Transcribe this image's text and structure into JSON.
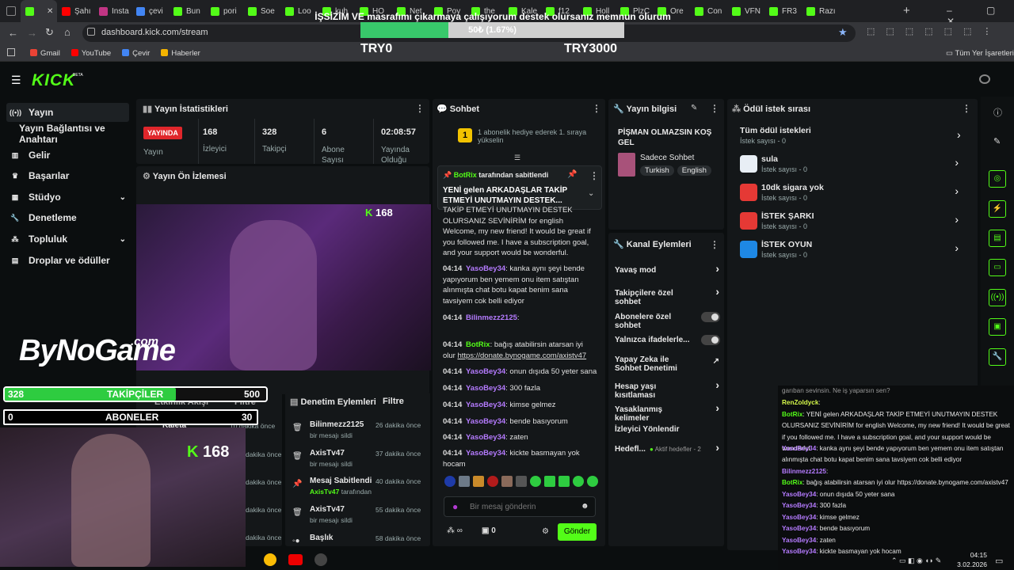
{
  "browser": {
    "tabs": [
      {
        "label": "",
        "color": "#53fc18"
      },
      {
        "label": "Şahı",
        "color": "#ff0000"
      },
      {
        "label": "Insta",
        "color": "#c13584"
      },
      {
        "label": "çevi",
        "color": "#4285f4"
      },
      {
        "label": "Bun",
        "color": "#53fc18"
      },
      {
        "label": "pori",
        "color": "#53fc18"
      },
      {
        "label": "Soe",
        "color": "#53fc18"
      },
      {
        "label": "Loo",
        "color": "#53fc18"
      },
      {
        "label": "kuh",
        "color": "#53fc18"
      },
      {
        "label": "HO",
        "color": "#53fc18"
      },
      {
        "label": "Net",
        "color": "#53fc18"
      },
      {
        "label": "Poy",
        "color": "#53fc18"
      },
      {
        "label": "the",
        "color": "#53fc18"
      },
      {
        "label": "Kale",
        "color": "#53fc18"
      },
      {
        "label": "f12",
        "color": "#53fc18"
      },
      {
        "label": "Holl",
        "color": "#53fc18"
      },
      {
        "label": "PlzC",
        "color": "#53fc18"
      },
      {
        "label": "Ore",
        "color": "#53fc18"
      },
      {
        "label": "Con",
        "color": "#53fc18"
      },
      {
        "label": "VFN",
        "color": "#53fc18"
      },
      {
        "label": "FR3",
        "color": "#53fc18"
      },
      {
        "label": "Razı",
        "color": "#53fc18"
      }
    ],
    "url": "dashboard.kick.com/stream",
    "bookmarks": [
      "Gmail",
      "YouTube",
      "Çevir",
      "Haberler"
    ],
    "all_bookmarks": "Tüm Yer İşaretleri"
  },
  "goal_overlay": {
    "title": "İŞSİZİM VE masrafımı çıkarmaya çalışıyorum destek olursanız memnun olurum",
    "progress_text": "50₺ (1.67%)",
    "progress_fraction": 0.0167,
    "left_label": "TRY0",
    "right_label": "TRY3000"
  },
  "brand": {
    "logo": "KICK",
    "beta": "BETA",
    "accent": "#53fc18"
  },
  "sidebar": {
    "items": [
      {
        "label": "Yayın",
        "icon": "broadcast-icon"
      },
      {
        "label": "Yayın Bağlantısı ve Anahtarı",
        "icon": ""
      },
      {
        "label": "Gelir",
        "icon": "money-icon"
      },
      {
        "label": "Başarılar",
        "icon": "trophy-icon"
      },
      {
        "label": "Stüdyo",
        "icon": "studio-icon"
      },
      {
        "label": "Denetleme",
        "icon": "wrench-icon"
      },
      {
        "label": "Topluluk",
        "icon": "community-icon"
      },
      {
        "label": "Droplar ve ödüller",
        "icon": "gift-icon"
      }
    ]
  },
  "stats": {
    "title": "Yayın İstatistikleri",
    "live_badge": "YAYINDA",
    "live_label": "Yayın",
    "viewers": "168",
    "viewers_label": "İzleyici",
    "followers": "328",
    "followers_label": "Takipçi",
    "subs": "6",
    "subs_label": "Abone Sayısı",
    "uptime": "02:08:57",
    "uptime_label": "Yayında Olduğu"
  },
  "preview": {
    "title": "Yayın Ön İzlemesi",
    "viewer_count": "168",
    "watermark": "ByNoGame",
    "watermark_sub": ".com"
  },
  "chat": {
    "title": "Sohbet",
    "gift_notice": "1 abonelik hediye ederek 1. sıraya yükselin",
    "pinned_by_user": "BotRix",
    "pinned_by_suffix": "tarafından sabitlendi",
    "pinned_text": "YENİ gelen ARKADAŞLAR TAKİP ETMEYİ UNUTMAYIN DESTEK...",
    "intro_text": "TAKİP ETMEYİ UNUTMAYIN DESTEK OLURSANIZ SEVİNİRİM for english Welcome, my new friend! It would be great if you followed me. I have a subscription goal, and your support would be wonderful.",
    "messages": [
      {
        "time": "04:14",
        "user": "YasoBey34",
        "text": "kanka aynı şeyi bende yapıyorum ben yemem onu item satıştan alınmışta chat botu kapat benim sana tavsiyem cok belli ediyor"
      },
      {
        "time": "04:14",
        "user": "Bilinmezz2125",
        "text": ""
      },
      {
        "time": "04:14",
        "user": "BotRix",
        "text": "bağış atabilirsin atarsan iyi olur",
        "link": "https://donate.bynogame.com/axistv47"
      },
      {
        "time": "04:14",
        "user": "YasoBey34",
        "text": "onun dışıda 50 yeter sana"
      },
      {
        "time": "04:14",
        "user": "YasoBey34",
        "text": "300 fazla"
      },
      {
        "time": "04:14",
        "user": "YasoBey34",
        "text": "kimse gelmez"
      },
      {
        "time": "04:14",
        "user": "YasoBey34",
        "text": "bende basıyorum"
      },
      {
        "time": "04:14",
        "user": "YasoBey34",
        "text": "zaten"
      },
      {
        "time": "04:14",
        "user": "YasoBey34",
        "text": "kickte basmayan yok hocam"
      }
    ],
    "input_placeholder": "Bir mesaj gönderin",
    "points": "0",
    "send_label": "Gönder"
  },
  "stream_info": {
    "title": "Yayın bilgisi",
    "stream_title": "PİŞMAN OLMAZSIN KOŞ GEL",
    "category": "Sadece Sohbet",
    "tags": [
      "Turkish",
      "English"
    ]
  },
  "channel_actions": {
    "title": "Kanal Eylemleri",
    "items": [
      {
        "label": "Yavaş mod",
        "control": "arrow"
      },
      {
        "label": "Takipçilere özel sohbet",
        "control": "arrow"
      },
      {
        "label": "Abonelere özel sohbet",
        "control": "toggle"
      },
      {
        "label": "Yalnızca ifadelerle...",
        "control": "toggle"
      },
      {
        "label": "Yapay Zeka ile Sohbet Denetimi",
        "control": "external"
      },
      {
        "label": "Hesap yaşı kısıtlaması",
        "control": "arrow"
      },
      {
        "label": "Yasaklanmış kelimeler",
        "control": "arrow"
      },
      {
        "label": "İzleyici Yönlendir",
        "control": "none"
      },
      {
        "label": "Hedefl...",
        "control": "arrow",
        "extra": "Aktif hedefler - 2"
      }
    ]
  },
  "rewards": {
    "title": "Ödül istek sırası",
    "all_label": "Tüm ödül istekleri",
    "all_count": "İstek sayısı - 0",
    "items": [
      {
        "label": "sula",
        "count": "İstek sayısı - 0",
        "color": "#e8eef5"
      },
      {
        "label": "10dk sigara yok",
        "count": "İstek sayısı - 0",
        "color": "#e53935"
      },
      {
        "label": "İSTEK ŞARKI",
        "count": "İstek sayısı - 0",
        "color": "#e53935"
      },
      {
        "label": "İSTEK OYUN",
        "count": "İstek sayısı - 0",
        "color": "#1e88e5"
      }
    ]
  },
  "activity": {
    "title": "Etkinlik Akışı",
    "filter": "Filtre",
    "items": [
      {
        "user": "Kaleta",
        "time": "10 dakika önce"
      },
      {
        "time": "dakika önce"
      },
      {
        "time": "dakika önce"
      },
      {
        "time": "dakika önce"
      },
      {
        "time": "dakika önce"
      }
    ]
  },
  "mod_actions": {
    "title": "Denetim Eylemleri",
    "filter": "Filtre",
    "items": [
      {
        "user": "Bilinmezz2125",
        "sub": "bir mesajı sildi",
        "time": "26 dakika önce",
        "icon": "trash-icon"
      },
      {
        "user": "AxisTv47",
        "sub": "bir mesajı sildi",
        "time": "37 dakika önce",
        "icon": "trash-icon"
      },
      {
        "user": "Mesaj Sabitlendi",
        "sub_user": "AxisTv47",
        "sub": "tarafından",
        "time": "40 dakika önce",
        "icon": "pin-icon"
      },
      {
        "user": "AxisTv47",
        "sub": "bir mesajı sildi",
        "time": "55 dakika önce",
        "icon": "trash-icon"
      },
      {
        "user": "Başlık",
        "sub": "",
        "time": "58 dakika önce",
        "icon": "title-icon"
      }
    ]
  },
  "overlay_goals": {
    "followers_current": "328",
    "followers_label": "TAKİPÇİLER",
    "followers_target": "500",
    "followers_fraction": 0.656,
    "subs_current": "0",
    "subs_label": "ABONELER",
    "subs_target": "30",
    "subs_fraction": 0
  },
  "webcam": {
    "viewer_count": "168"
  },
  "bottom_chat": [
    {
      "user": "RenZoldyck",
      "text": ":",
      "color": "#d4f74a"
    },
    {
      "user": "BotRix",
      "text": ": YENİ gelen ARKADAŞLAR TAKİP ETMEYİ UNUTMAYIN DESTEK OLURSANIZ SEVİNİRİM for english Welcome, my new friend! It would be great if you followed me. I have a subscription goal, and your support would be wonderful.",
      "color": "#53fc18"
    },
    {
      "user": "YasoBey34",
      "text": ": kanka aynı şeyi bende yapıyorum ben yemem onu item satıştan alınmışta chat botu kapat benim sana tavsiyem cok belli ediyor",
      "color": "#b57bff"
    },
    {
      "user": "Bilinmezz2125",
      "text": ":",
      "color": "#b57bff"
    },
    {
      "user": "BotRix",
      "text": ": bağış atabilirsin atarsan iyi olur https://donate.bynogame.com/axistv47",
      "color": "#53fc18"
    },
    {
      "user": "YasoBey34",
      "text": ": onun dışıda 50 yeter sana",
      "color": "#b57bff"
    },
    {
      "user": "YasoBey34",
      "text": ": 300 fazla",
      "color": "#b57bff"
    },
    {
      "user": "YasoBey34",
      "text": ": kimse gelmez",
      "color": "#b57bff"
    },
    {
      "user": "YasoBey34",
      "text": ": bende basıyorum",
      "color": "#b57bff"
    },
    {
      "user": "YasoBey34",
      "text": ": zaten",
      "color": "#b57bff"
    },
    {
      "user": "YasoBey34",
      "text": ": kickte basmayan yok hocam",
      "color": "#b57bff"
    }
  ],
  "bottom_chat_intro": "garıban sevinsin. Ne iş yaparsın sen?",
  "taskbar": {
    "time": "04:15",
    "date": "3.02.2026"
  }
}
